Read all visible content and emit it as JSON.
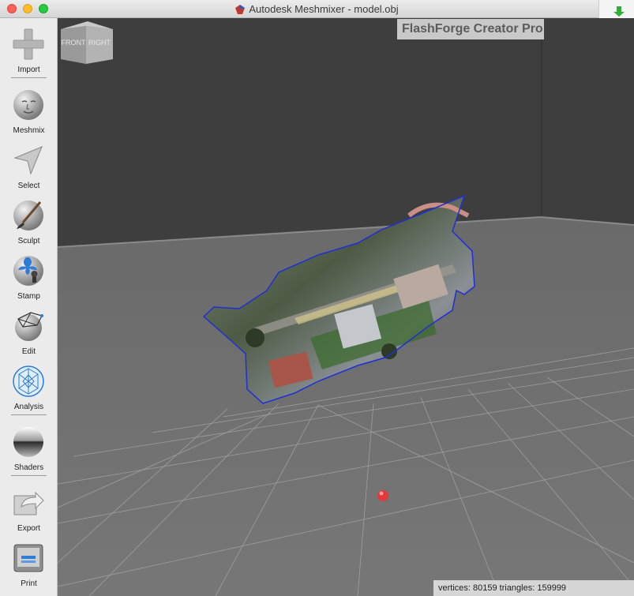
{
  "window": {
    "title": "Autodesk Meshmixer - model.obj",
    "app_icon": "meshmixer-logo-icon",
    "corner_icon": "download-install-icon"
  },
  "toolbar": {
    "items": [
      {
        "label": "Import",
        "icon": "plus-icon"
      },
      {
        "label": "Meshmix",
        "icon": "face-sphere-icon"
      },
      {
        "label": "Select",
        "icon": "arrow-cursor-icon"
      },
      {
        "label": "Sculpt",
        "icon": "brush-sphere-icon"
      },
      {
        "label": "Stamp",
        "icon": "fleur-de-lis-stamp-icon"
      },
      {
        "label": "Edit",
        "icon": "wireframe-sphere-icon"
      },
      {
        "label": "Analysis",
        "icon": "mesh-analysis-icon"
      },
      {
        "label": "Shaders",
        "icon": "chrome-sphere-icon"
      },
      {
        "label": "Export",
        "icon": "export-arrow-icon"
      },
      {
        "label": "Print",
        "icon": "printer-icon"
      }
    ]
  },
  "viewport": {
    "printer_name": "FlashForge Creator Pro",
    "viewcube": {
      "front": "FRONT",
      "right": "RIGHT"
    },
    "status": "vertices: 80159 triangles: 159999"
  },
  "colors": {
    "selection_outline": "#1f2fd6",
    "pivot": "#e03a3a",
    "floor": "#6d6d6d",
    "back_wall": "#3d3d3d"
  }
}
